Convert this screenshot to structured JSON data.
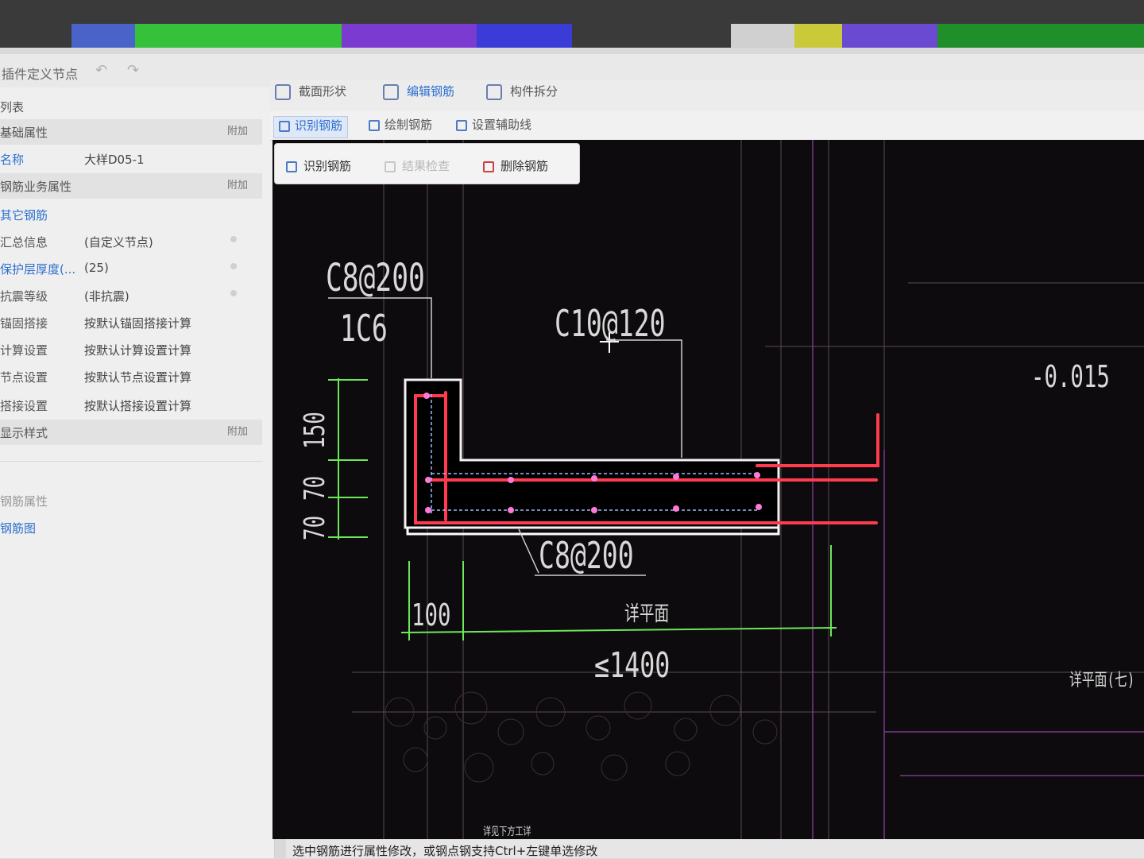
{
  "window": {
    "title": "插件定义节点"
  },
  "left_panel": {
    "list_header": "列表",
    "basic_props": {
      "label": "基础属性",
      "extra": "附加"
    },
    "name": {
      "key": "名称",
      "value": "大样D05-1"
    },
    "rebar_props": {
      "label": "钢筋业务属性",
      "extra": "附加"
    },
    "rows": [
      {
        "key": "其它钢筋",
        "value": ""
      },
      {
        "key": "汇总信息",
        "value": "(自定义节点)"
      },
      {
        "key": "保护层厚度(...",
        "value": "(25)"
      },
      {
        "key": "抗震等级",
        "value": "(非抗震)"
      },
      {
        "key": "锚固搭接",
        "value": "按默认锚固搭接计算"
      },
      {
        "key": "计算设置",
        "value": "按默认计算设置计算"
      },
      {
        "key": "节点设置",
        "value": "按默认节点设置计算"
      },
      {
        "key": "搭接设置",
        "value": "按默认搭接设置计算"
      }
    ],
    "display_style": {
      "label": "显示样式",
      "extra": "附加"
    },
    "section_props": "钢筋属性",
    "rebar_section": "钢筋图"
  },
  "tabs": [
    {
      "label": "截面形状",
      "active": false
    },
    {
      "label": "编辑钢筋",
      "active": true
    },
    {
      "label": "构件拆分",
      "active": false
    }
  ],
  "sub_toolbar": [
    {
      "label": "识别钢筋",
      "active": true
    },
    {
      "label": "绘制钢筋",
      "active": false
    },
    {
      "label": "设置辅助线",
      "active": false
    }
  ],
  "popup": {
    "recognize": "识别钢筋",
    "check": "结果检查",
    "delete": "删除钢筋"
  },
  "drawing": {
    "rebar_top_left": "C8@200",
    "rebar_count": "1C6",
    "rebar_top_right": "C10@120",
    "rebar_bottom": "C8@200",
    "elevation": "-0.015",
    "dim_150": "150",
    "dim_70a": "70",
    "dim_70b": "70",
    "dim_100": "100",
    "dim_1400": "≤1400",
    "label_mid": "详平面",
    "label_right": "详平面(七)",
    "label_bottom": "详见下方工详"
  },
  "status": "选中钢筋进行属性修改，或钢点钢支持Ctrl+左键单选修改",
  "colors": {
    "canvas_bg": "#0d0b0d",
    "rebar": "#ff3b4e",
    "outline": "#ffffff",
    "dimension": "#6de85a",
    "accent": "#2d6fcf"
  }
}
